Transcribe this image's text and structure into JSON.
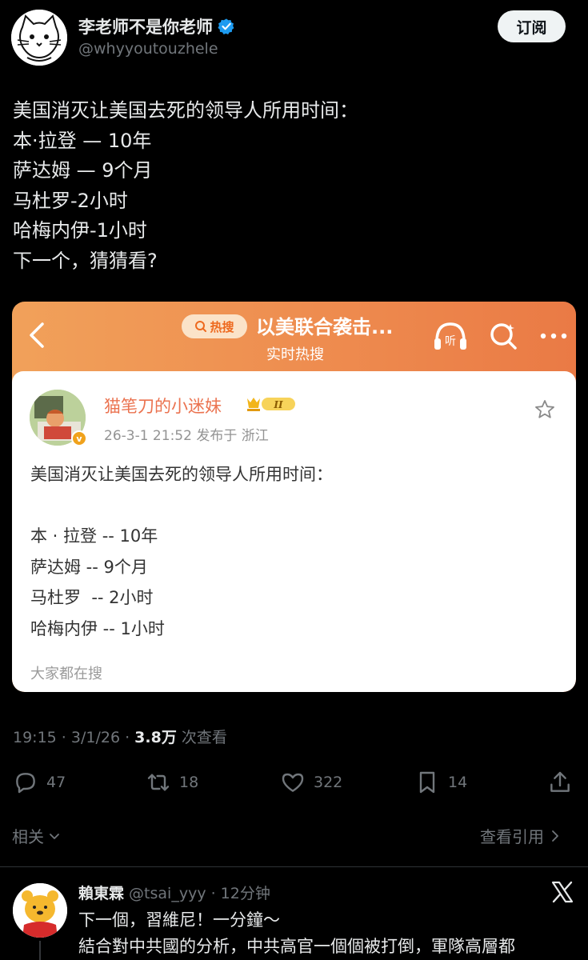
{
  "author": {
    "display_name": "李老师不是你老师",
    "handle": "@whyyoutouzhele",
    "follow_label": "订阅"
  },
  "tweet": {
    "lines": [
      "美国消灭让美国去死的领导人所用时间：",
      "本·拉登 — 10年",
      "萨达姆 — 9个月",
      "马杜罗-2小时",
      "哈梅内伊-1小时",
      "下一个，猜猜看?"
    ]
  },
  "embedded": {
    "hot_badge": "热搜",
    "hot_title": "以美联合袭击...",
    "hot_subtitle": "实时热搜",
    "listen_label": "听",
    "weibo": {
      "name": "猫笔刀的小迷妹",
      "level": "II",
      "meta": "26-3-1 21:52  发布于 浙江",
      "badge": "v",
      "lines": [
        "美国消灭让美国去死的领导人所用时间：",
        "",
        "本 · 拉登 -- 10年",
        "萨达姆 -- 9个月",
        "马杜罗  -- 2小时",
        "哈梅内伊 -- 1小时"
      ],
      "footer": "大家都在搜"
    }
  },
  "stats": {
    "time": "19:15 · 3/1/26 · ",
    "views_count": "3.8万",
    "views_label": " 次查看",
    "replies": "47",
    "reposts": "18",
    "likes": "322",
    "bookmarks": "14"
  },
  "related": {
    "label": "相关",
    "quotes_label": "查看引用"
  },
  "reply": {
    "name": "賴東霖",
    "handle": " @tsai_yyy · 12分钟",
    "lines": [
      "下一個，習維尼！一分鐘～",
      "結合對中共國的分析，中共高官一個個被打倒，軍隊高層都"
    ]
  },
  "colors": {
    "background": "#000000",
    "text_primary": "#e7e9ea",
    "text_secondary": "#71767b",
    "verified_blue": "#1d9bf0",
    "weibo_orange": "#eb7350",
    "card_gradient_start": "#f1a15a",
    "card_gradient_end": "#ea7a45"
  }
}
